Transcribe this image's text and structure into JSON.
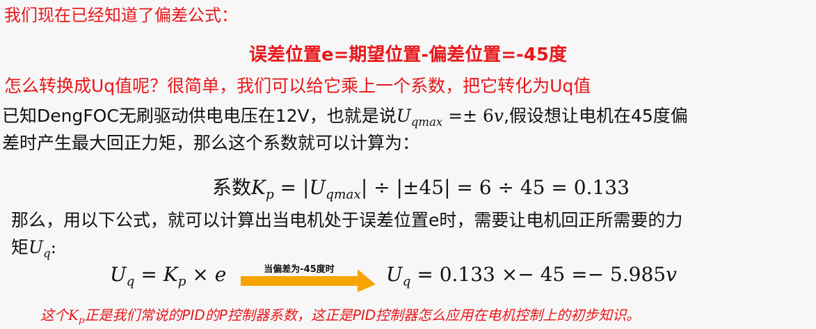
{
  "line1": "我们现在已经知道了偏差公式：",
  "line2": "误差位置e=期望位置-偏差位置=-45度",
  "line3": "怎么转换成Uq值呢？很简单，我们可以给它乘上一个系数，把它转化为Uq值",
  "line4": {
    "pre": "已知DengFOC无刷驱动供电电压在12V，也就是说",
    "sym": "U",
    "sub": "qmax",
    "eq": " =± 6",
    "unit": "v",
    "post": ",假设想让电机在45度偏"
  },
  "line5": "差时产生最大回正力矩，那么这个系数就可以计算为：",
  "line6": {
    "pre": "系数",
    "k": "K",
    "k_sub": "p",
    "eq": " = |",
    "u": "U",
    "u_sub": "qmax",
    "post": "| ÷ |±45| = 6 ÷ 45 = 0.133"
  },
  "line7": "那么，用以下公式，就可以计算出当电机处于误差位置e时，需要让电机回正所需要的力",
  "line8": {
    "pre": "矩",
    "u": "U",
    "u_sub": "q",
    "post": ":"
  },
  "eq_left": {
    "u": "U",
    "u_sub": "q",
    "eq": " = ",
    "k": "K",
    "k_sub": "p",
    "times": " × ",
    "e": "e"
  },
  "arrow_label": "当偏差为-45度时",
  "eq_right": {
    "u": "U",
    "u_sub": "q",
    "value": " = 0.133 ×− 45 =− 5.985",
    "unit": "v"
  },
  "footer": {
    "pre": "这个",
    "k": "K",
    "k_sub": "p",
    "post": "正是我们常说的PID的P控制器系数，这正是PID控制器怎么应用在电机控制上的初步知识。"
  },
  "colors": {
    "accent_red": "#e8171b",
    "arrow_orange": "#f6a500",
    "text": "#111111",
    "background": "#f7f7f7"
  }
}
